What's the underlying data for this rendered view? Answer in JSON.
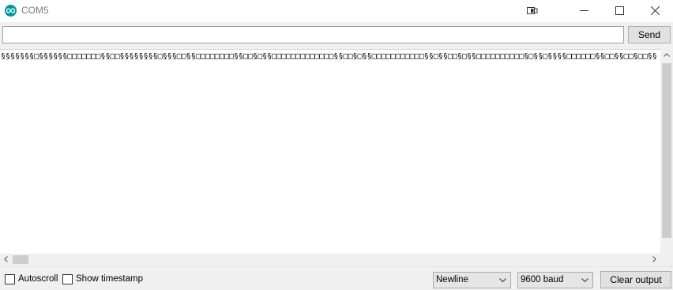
{
  "window": {
    "title": "COM5",
    "icon": "arduino-icon",
    "controls": [
      "connection-icon",
      "minimize-icon",
      "maximize-icon",
      "close-icon"
    ]
  },
  "send_row": {
    "input_value": "",
    "send_label": "Send"
  },
  "output": {
    "text": "§§§§§§§□§§§§§§□□□□□□□§§□□§§§§§§§§□§§§□□§§□□□□□□□□§§□□§□§§□□□□□□□□□□□□□§§□□§□§§□□□□□□□□□□□§§□§§□□§□§§□□□□□□□□□□§□§§□§§§§□□□□□□§§□□§§□□§□□§§"
  },
  "footer": {
    "autoscroll_label": "Autoscroll",
    "autoscroll_checked": false,
    "timestamp_label": "Show timestamp",
    "timestamp_checked": false,
    "line_ending": "Newline",
    "baud_rate": "9600 baud",
    "clear_label": "Clear output"
  },
  "colors": {
    "brand": "#00979c",
    "background": "#f0f0f0",
    "button": "#e1e1e1"
  }
}
